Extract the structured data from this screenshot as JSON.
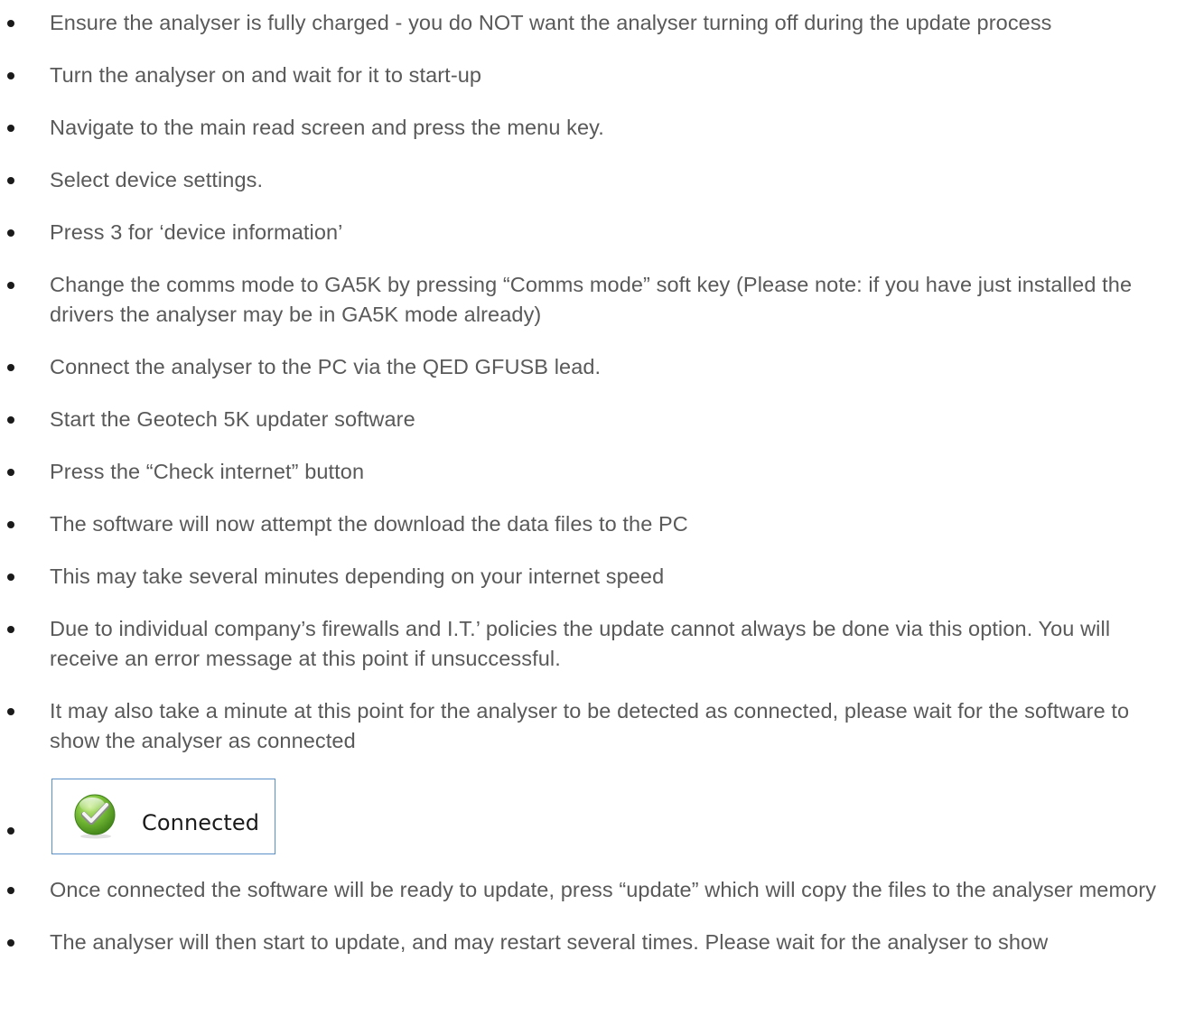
{
  "steps": [
    "Ensure the analyser is fully charged - you do NOT want the analyser turning off during the update process",
    "Turn the analyser on and wait for it to start-up",
    "Navigate to the main read screen and press the menu key.",
    "Select device settings.",
    "Press 3 for ‘device information’",
    "Change the comms mode to GA5K by pressing “Comms mode” soft key (Please note: if you have just installed the drivers the analyser may be in GA5K mode already)",
    "Connect the analyser to the PC via the QED GFUSB lead.",
    "Start the Geotech 5K updater software",
    "Press the “Check internet” button",
    "The software will now attempt the download the data files to the PC",
    "This may take several minutes depending on your internet speed",
    "Due to individual company’s firewalls and I.T.’ policies the update cannot always be done via this option. You will receive an error message at this point if unsuccessful.",
    "It may also take a minute at this point for the analyser to be detected as connected, please wait for the software to show the analyser as connected"
  ],
  "status_image": {
    "label": "Connected",
    "icon": "green-check-icon",
    "border_color": "#5b8fc7",
    "icon_color": "#5ea827"
  },
  "steps_after": [
    "Once connected the software will be ready to update, press “update” which will copy the files to the analyser memory",
    "The analyser will then start to update, and may restart several times. Please wait for the analyser to show"
  ]
}
